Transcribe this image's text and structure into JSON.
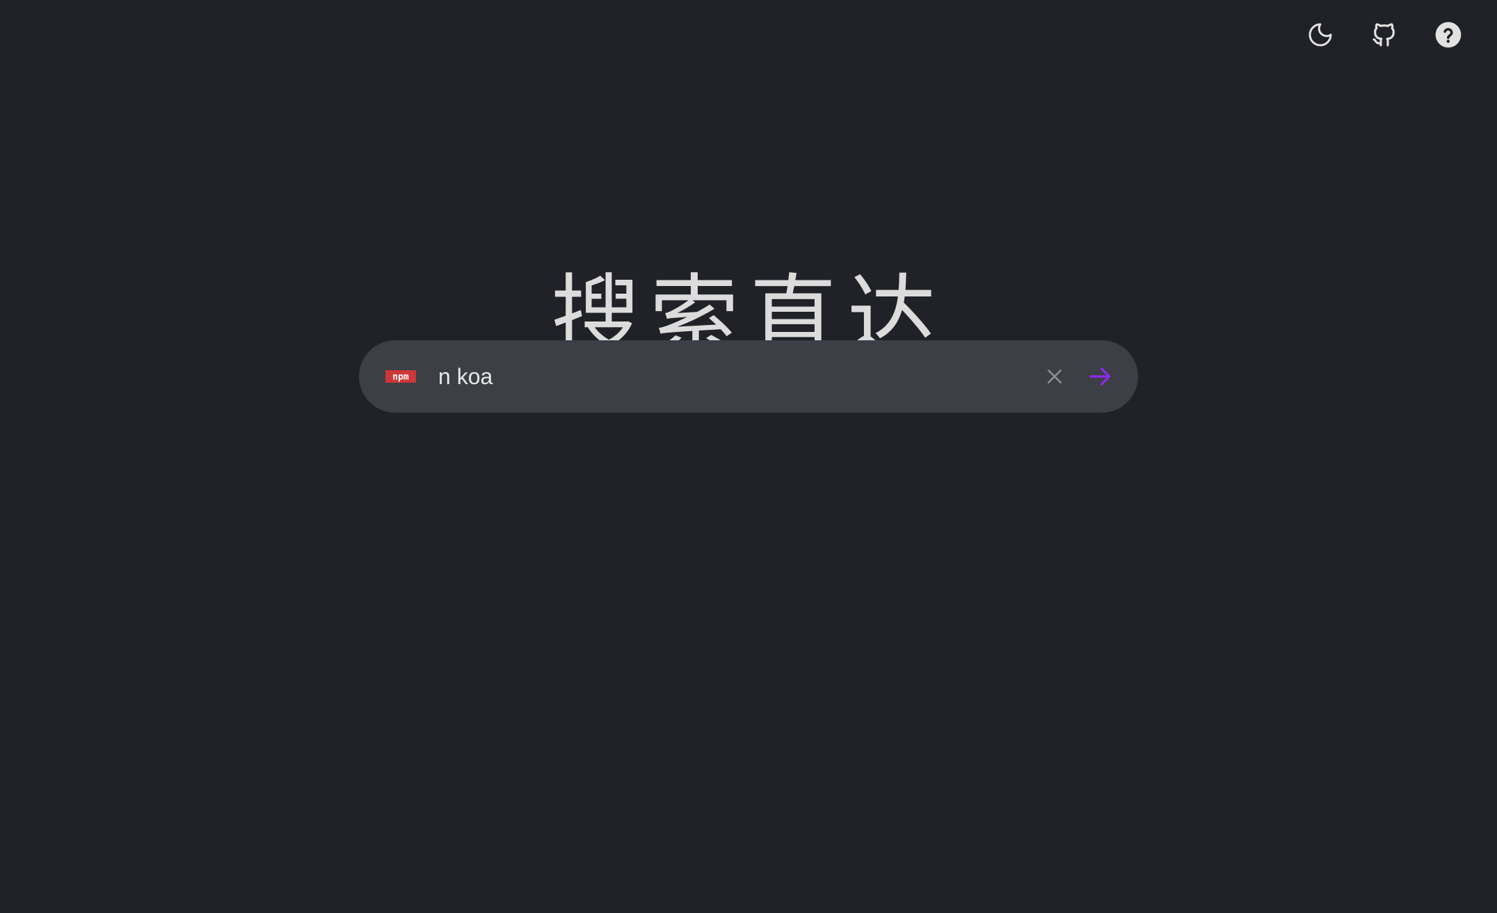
{
  "header": {
    "actions": [
      {
        "icon": "moon-icon",
        "label": "theme"
      },
      {
        "icon": "github-icon",
        "label": "github"
      },
      {
        "icon": "help-icon",
        "label": "help"
      }
    ]
  },
  "main": {
    "title": "搜索直达"
  },
  "search": {
    "engine_icon": "npm-icon",
    "engine_logo_text": "npm",
    "engine_color": "#cb3837",
    "value": "n koa",
    "clear_icon": "close-icon",
    "submit_icon": "arrow-right-icon",
    "accent_color": "#8b2bf0"
  },
  "colors": {
    "background": "#202227",
    "search_bg": "#3c3f45",
    "text": "#dcdcdc"
  }
}
